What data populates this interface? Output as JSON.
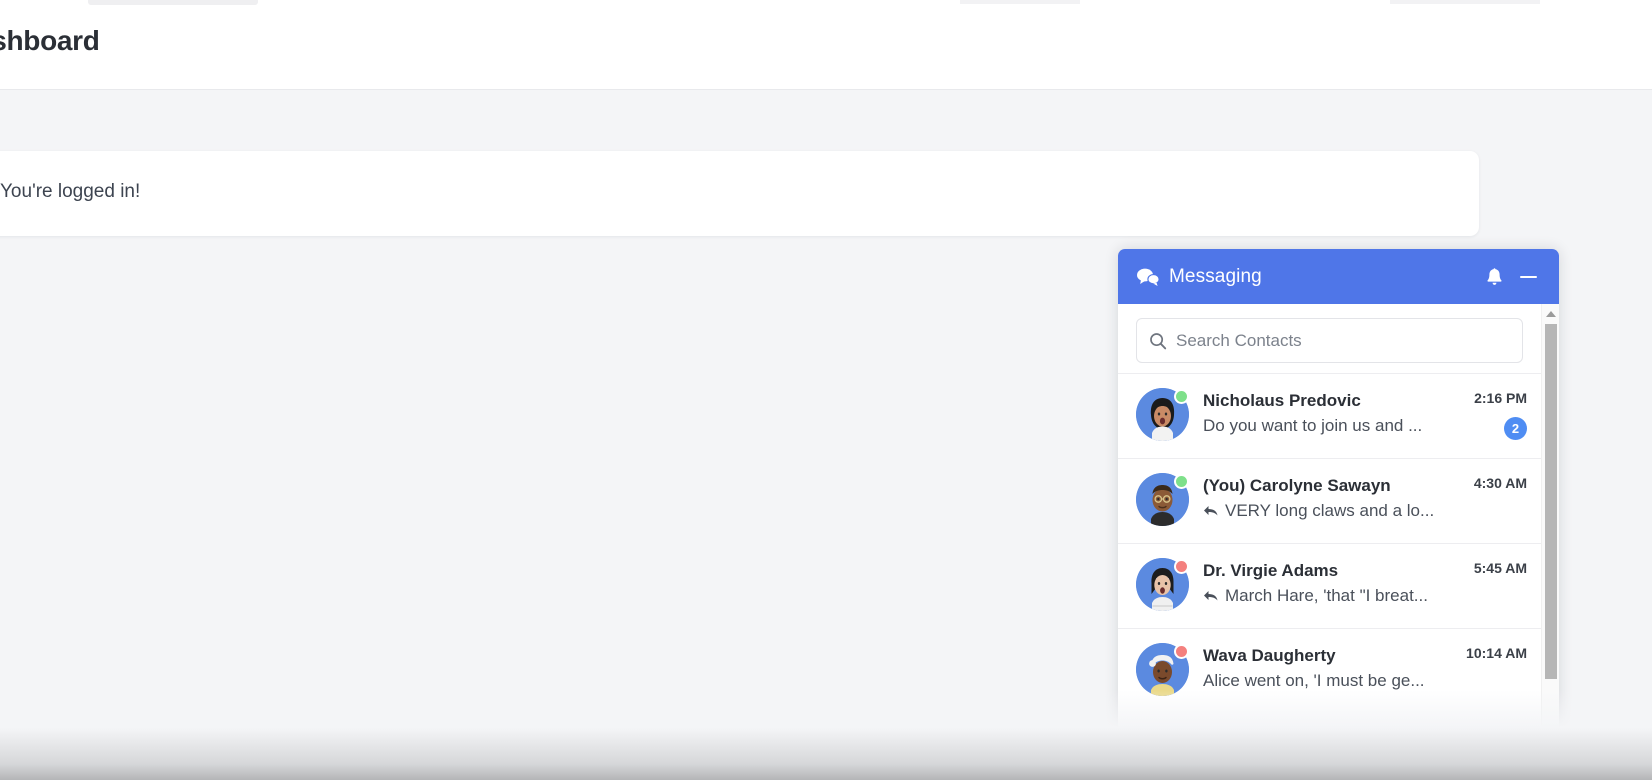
{
  "header": {
    "page_title": "Dashboard"
  },
  "main": {
    "status_card_text": "You're logged in!"
  },
  "messaging": {
    "title": "Messaging",
    "header_icon": "chat-bubbles-icon",
    "notifications_icon": "bell-icon",
    "minimize_icon": "minimize-icon",
    "header_color": "#4f76e8",
    "badge_color": "#4f8df3",
    "online_color": "#7ee08a",
    "away_color": "#f4807e",
    "search": {
      "placeholder": "Search Contacts",
      "value": "",
      "icon": "search-icon"
    },
    "contacts": [
      {
        "name": "Nicholaus Predovic",
        "preview": "Do you want to join us and ...",
        "time": "2:16 PM",
        "unread": "2",
        "status": "online",
        "replied": false
      },
      {
        "name": "(You) Carolyne Sawayn",
        "preview": "VERY long claws and a lo...",
        "time": "4:30 AM",
        "unread": "",
        "status": "online",
        "replied": true
      },
      {
        "name": "Dr. Virgie Adams",
        "preview": "March Hare, 'that \"I breat...",
        "time": "5:45 AM",
        "unread": "",
        "status": "away",
        "replied": true
      },
      {
        "name": "Wava Daugherty",
        "preview": "Alice went on, 'I must be ge...",
        "time": "10:14 AM",
        "unread": "",
        "status": "away",
        "replied": false
      }
    ]
  }
}
